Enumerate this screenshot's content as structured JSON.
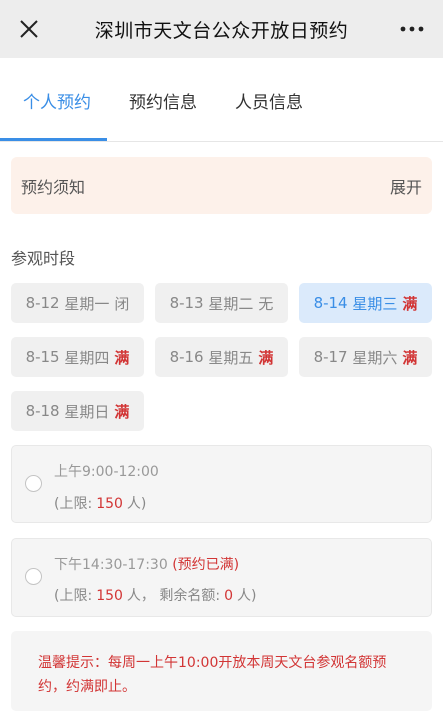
{
  "window": {
    "title": "深圳市天文台公众开放日预约",
    "close_icon": "close-icon",
    "more_icon": "more-icon"
  },
  "tabs": [
    {
      "label": "个人预约",
      "active": true
    },
    {
      "label": "预约信息",
      "active": false
    },
    {
      "label": "人员信息",
      "active": false
    }
  ],
  "notice": {
    "label": "预约须知",
    "action": "展开"
  },
  "section": {
    "label": "参观时段"
  },
  "dates": [
    {
      "date": "8-12",
      "weekday": "星期一",
      "status": "闭",
      "full": false,
      "selected": false
    },
    {
      "date": "8-13",
      "weekday": "星期二",
      "status": "无",
      "full": false,
      "selected": false
    },
    {
      "date": "8-14",
      "weekday": "星期三",
      "status": "满",
      "full": true,
      "selected": true
    },
    {
      "date": "8-15",
      "weekday": "星期四",
      "status": "满",
      "full": true,
      "selected": false
    },
    {
      "date": "8-16",
      "weekday": "星期五",
      "status": "满",
      "full": true,
      "selected": false
    },
    {
      "date": "8-17",
      "weekday": "星期六",
      "status": "满",
      "full": true,
      "selected": false
    },
    {
      "date": "8-18",
      "weekday": "星期日",
      "status": "满",
      "full": true,
      "selected": false
    }
  ],
  "slots": [
    {
      "time": "上午9:00-12:00",
      "tag": "",
      "limit_prefix": "(上限:",
      "limit_value": "150",
      "limit_unit": "人",
      "remaining_label": "",
      "remaining_value": "",
      "remaining_unit": "",
      "suffix": ")"
    },
    {
      "time": "下午14:30-17:30",
      "tag": "(预约已满)",
      "limit_prefix": "(上限:",
      "limit_value": "150",
      "limit_unit": "人，",
      "remaining_label": "剩余名额:",
      "remaining_value": "0",
      "remaining_unit": "人",
      "suffix": ")"
    }
  ],
  "tip": {
    "text": "温馨提示：每周一上午10:00开放本周天文台参观名额预约，约满即止。"
  },
  "colors": {
    "accent": "#3a8ee6",
    "full": "#d23535",
    "notice_bg": "#fdf1ea"
  }
}
